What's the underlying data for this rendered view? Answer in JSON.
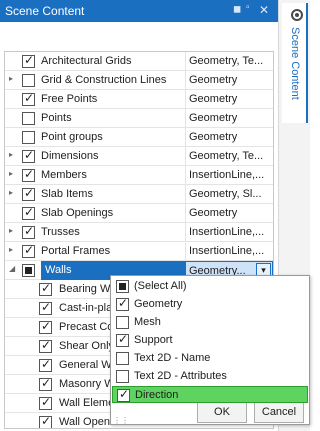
{
  "panel": {
    "title": "Scene Content",
    "pin_icon": "pin-icon",
    "minimize_icon": "minimize-icon",
    "close_icon": "close-icon"
  },
  "side_tab": {
    "label": "Scene Content",
    "icon": "scene-content-icon"
  },
  "tree": {
    "rows": [
      {
        "expander": "",
        "check": "checked",
        "name": "Architectural Grids",
        "value": "Geometry, Te..."
      },
      {
        "expander": "▸",
        "check": "unchecked",
        "name": "Grid & Construction Lines",
        "value": "Geometry"
      },
      {
        "expander": "",
        "check": "checked",
        "name": "Free Points",
        "value": "Geometry"
      },
      {
        "expander": "",
        "check": "unchecked",
        "name": "Points",
        "value": "Geometry"
      },
      {
        "expander": "",
        "check": "unchecked",
        "name": "Point groups",
        "value": "Geometry"
      },
      {
        "expander": "▸",
        "check": "checked",
        "name": "Dimensions",
        "value": "Geometry, Te..."
      },
      {
        "expander": "▸",
        "check": "checked",
        "name": "Members",
        "value": "InsertionLine,..."
      },
      {
        "expander": "▸",
        "check": "checked",
        "name": "Slab Items",
        "value": "Geometry, Sl..."
      },
      {
        "expander": "",
        "check": "checked",
        "name": "Slab Openings",
        "value": "Geometry"
      },
      {
        "expander": "▸",
        "check": "checked",
        "name": "Trusses",
        "value": "InsertionLine,..."
      },
      {
        "expander": "▸",
        "check": "checked",
        "name": "Portal Frames",
        "value": "InsertionLine,..."
      },
      {
        "expander": "◢",
        "check": "partial",
        "name": "Walls",
        "value": "Geometry...",
        "selected": true
      },
      {
        "expander": "",
        "check": "checked",
        "name": "Bearing W",
        "value": "",
        "sub": true
      },
      {
        "expander": "",
        "check": "checked",
        "name": "Cast-in-pla",
        "value": "",
        "sub": true
      },
      {
        "expander": "",
        "check": "checked",
        "name": "Precast Co",
        "value": "",
        "sub": true
      },
      {
        "expander": "",
        "check": "checked",
        "name": "Shear Only",
        "value": "",
        "sub": true
      },
      {
        "expander": "",
        "check": "checked",
        "name": "General W",
        "value": "",
        "sub": true
      },
      {
        "expander": "",
        "check": "checked",
        "name": "Masonry W",
        "value": "",
        "sub": true
      },
      {
        "expander": "",
        "check": "checked",
        "name": "Wall Eleme",
        "value": "",
        "sub": true
      },
      {
        "expander": "",
        "check": "checked",
        "name": "Wall Openi",
        "value": "",
        "sub": true
      }
    ],
    "dropdown_icon": "chevron-down-icon"
  },
  "popup": {
    "options": [
      {
        "label": "(Select All)",
        "check": "partial"
      },
      {
        "label": "Geometry",
        "check": "checked"
      },
      {
        "label": "Mesh",
        "check": "unchecked"
      },
      {
        "label": "Support",
        "check": "checked"
      },
      {
        "label": "Text 2D - Name",
        "check": "unchecked"
      },
      {
        "label": "Text 2D - Attributes",
        "check": "unchecked"
      },
      {
        "label": "Direction",
        "check": "checked",
        "highlighted": true
      }
    ],
    "ok_label": "OK",
    "cancel_label": "Cancel",
    "highlight_color": "#5fd35f"
  },
  "colors": {
    "accent": "#1b6fc0",
    "selected_row": "#1b6fc0"
  }
}
